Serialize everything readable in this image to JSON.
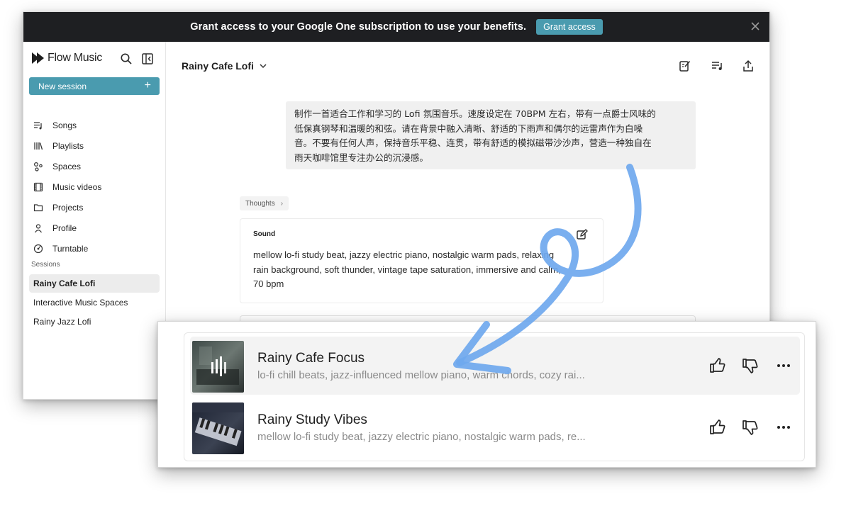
{
  "banner": {
    "text": "Grant access to your Google One subscription to use your benefits.",
    "button": "Grant access"
  },
  "sidebar": {
    "brand": "Flow Music",
    "new_session": "New session",
    "nav": [
      {
        "label": "Songs",
        "icon": "songs-icon"
      },
      {
        "label": "Playlists",
        "icon": "playlists-icon"
      },
      {
        "label": "Spaces",
        "icon": "spaces-icon"
      },
      {
        "label": "Music videos",
        "icon": "music-videos-icon"
      },
      {
        "label": "Projects",
        "icon": "folder-icon"
      },
      {
        "label": "Profile",
        "icon": "profile-icon"
      },
      {
        "label": "Turntable",
        "icon": "turntable-icon"
      }
    ],
    "sessions_label": "Sessions",
    "sessions": [
      "Rainy Cafe Lofi",
      "Interactive Music Spaces",
      "Rainy Jazz Lofi"
    ]
  },
  "main": {
    "title": "Rainy Cafe Lofi",
    "prompt": [
      "制作一首适合工作和学习的 Lofi 氛围音乐。速度设定在 70BPM 左右，带有一点爵士风味的",
      "低保真钢琴和温暖的和弦。请在背景中融入清晰、舒适的下雨声和偶尔的远雷声作为白噪",
      "音。不要有任何人声，保持音乐平稳、连贯，带有舒适的模拟磁带沙沙声，营造一种独自在",
      "雨天咖啡馆里专注办公的沉浸感。"
    ],
    "thoughts_label": "Thoughts",
    "sound": {
      "label": "Sound",
      "lines": [
        "mellow lo-fi study beat, jazzy electric piano, nostalgic warm pads, relaxing",
        "rain background, soft thunder, vintage tape saturation, immersive and calm,",
        "70 bpm"
      ]
    }
  },
  "tracks": [
    {
      "title": "Rainy Cafe Focus",
      "description": "lo-fi chill beats, jazz-influenced mellow piano, warm chords, cozy rai...",
      "state": "playing"
    },
    {
      "title": "Rainy Study Vibes",
      "description": "mellow lo-fi study beat, jazzy electric piano, nostalgic warm pads, re..."
    }
  ],
  "colors": {
    "accent": "#4a9baf",
    "banner_bg": "#1e1f22",
    "annotation_arrow": "#6fa8ee"
  }
}
